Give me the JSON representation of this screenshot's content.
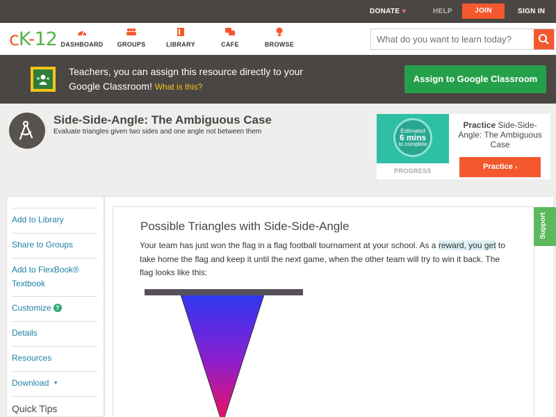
{
  "topbar": {
    "donate": "DONATE",
    "help": "HELP",
    "join": "JOIN",
    "signin": "SIGN IN"
  },
  "logo": {
    "c": "c",
    "k": "K",
    "dash": "-",
    "num": "12"
  },
  "nav": {
    "items": [
      {
        "label": "DASHBOARD",
        "icon": "dashboard-icon"
      },
      {
        "label": "GROUPS",
        "icon": "groups-icon"
      },
      {
        "label": "LIBRARY",
        "icon": "library-icon"
      },
      {
        "label": "CAFE",
        "icon": "cafe-icon"
      },
      {
        "label": "BROWSE",
        "icon": "browse-icon"
      }
    ],
    "search_placeholder": "What do you want to learn today?"
  },
  "banner": {
    "text": "Teachers, you can assign this resource directly to your Google Classroom!",
    "what_link": "What is this?",
    "assign_button": "Assign to Google Classroom"
  },
  "header": {
    "title": "Side-Side-Angle: The Ambiguous Case",
    "subtitle": "Evaluate triangles given two sides and one angle not between them"
  },
  "practice": {
    "ring_line1": "Estimated",
    "ring_line2": "6 mins",
    "ring_line3": "to complete",
    "progress_label": "PROGRESS",
    "title_bold": "Practice",
    "title_rest": "Side-Side-Angle: The Ambiguous Case",
    "button": "Practice"
  },
  "sidebar": {
    "items": [
      {
        "label": "Add to Library"
      },
      {
        "label": "Share to Groups"
      },
      {
        "label": "Add to FlexBook® Textbook"
      },
      {
        "label": "Customize"
      },
      {
        "label": "Details"
      },
      {
        "label": "Resources"
      },
      {
        "label": "Download"
      }
    ],
    "customize_help": "?",
    "download_caret": "▼",
    "quick_tips": "Quick Tips"
  },
  "content": {
    "title": "Possible Triangles with Side-Side-Angle",
    "para_before": "Your team has just won the flag in a flag football tournament at your school. As a ",
    "para_highlight": "reward, you get",
    "para_after": " to take home the flag and keep it until the next game, when the other team will try to win it back. The flag looks like this:"
  },
  "support": "Support",
  "colors": {
    "accent": "#f4582e",
    "green": "#25a04a",
    "dark": "#4a4643",
    "link": "#1e7fa3"
  }
}
